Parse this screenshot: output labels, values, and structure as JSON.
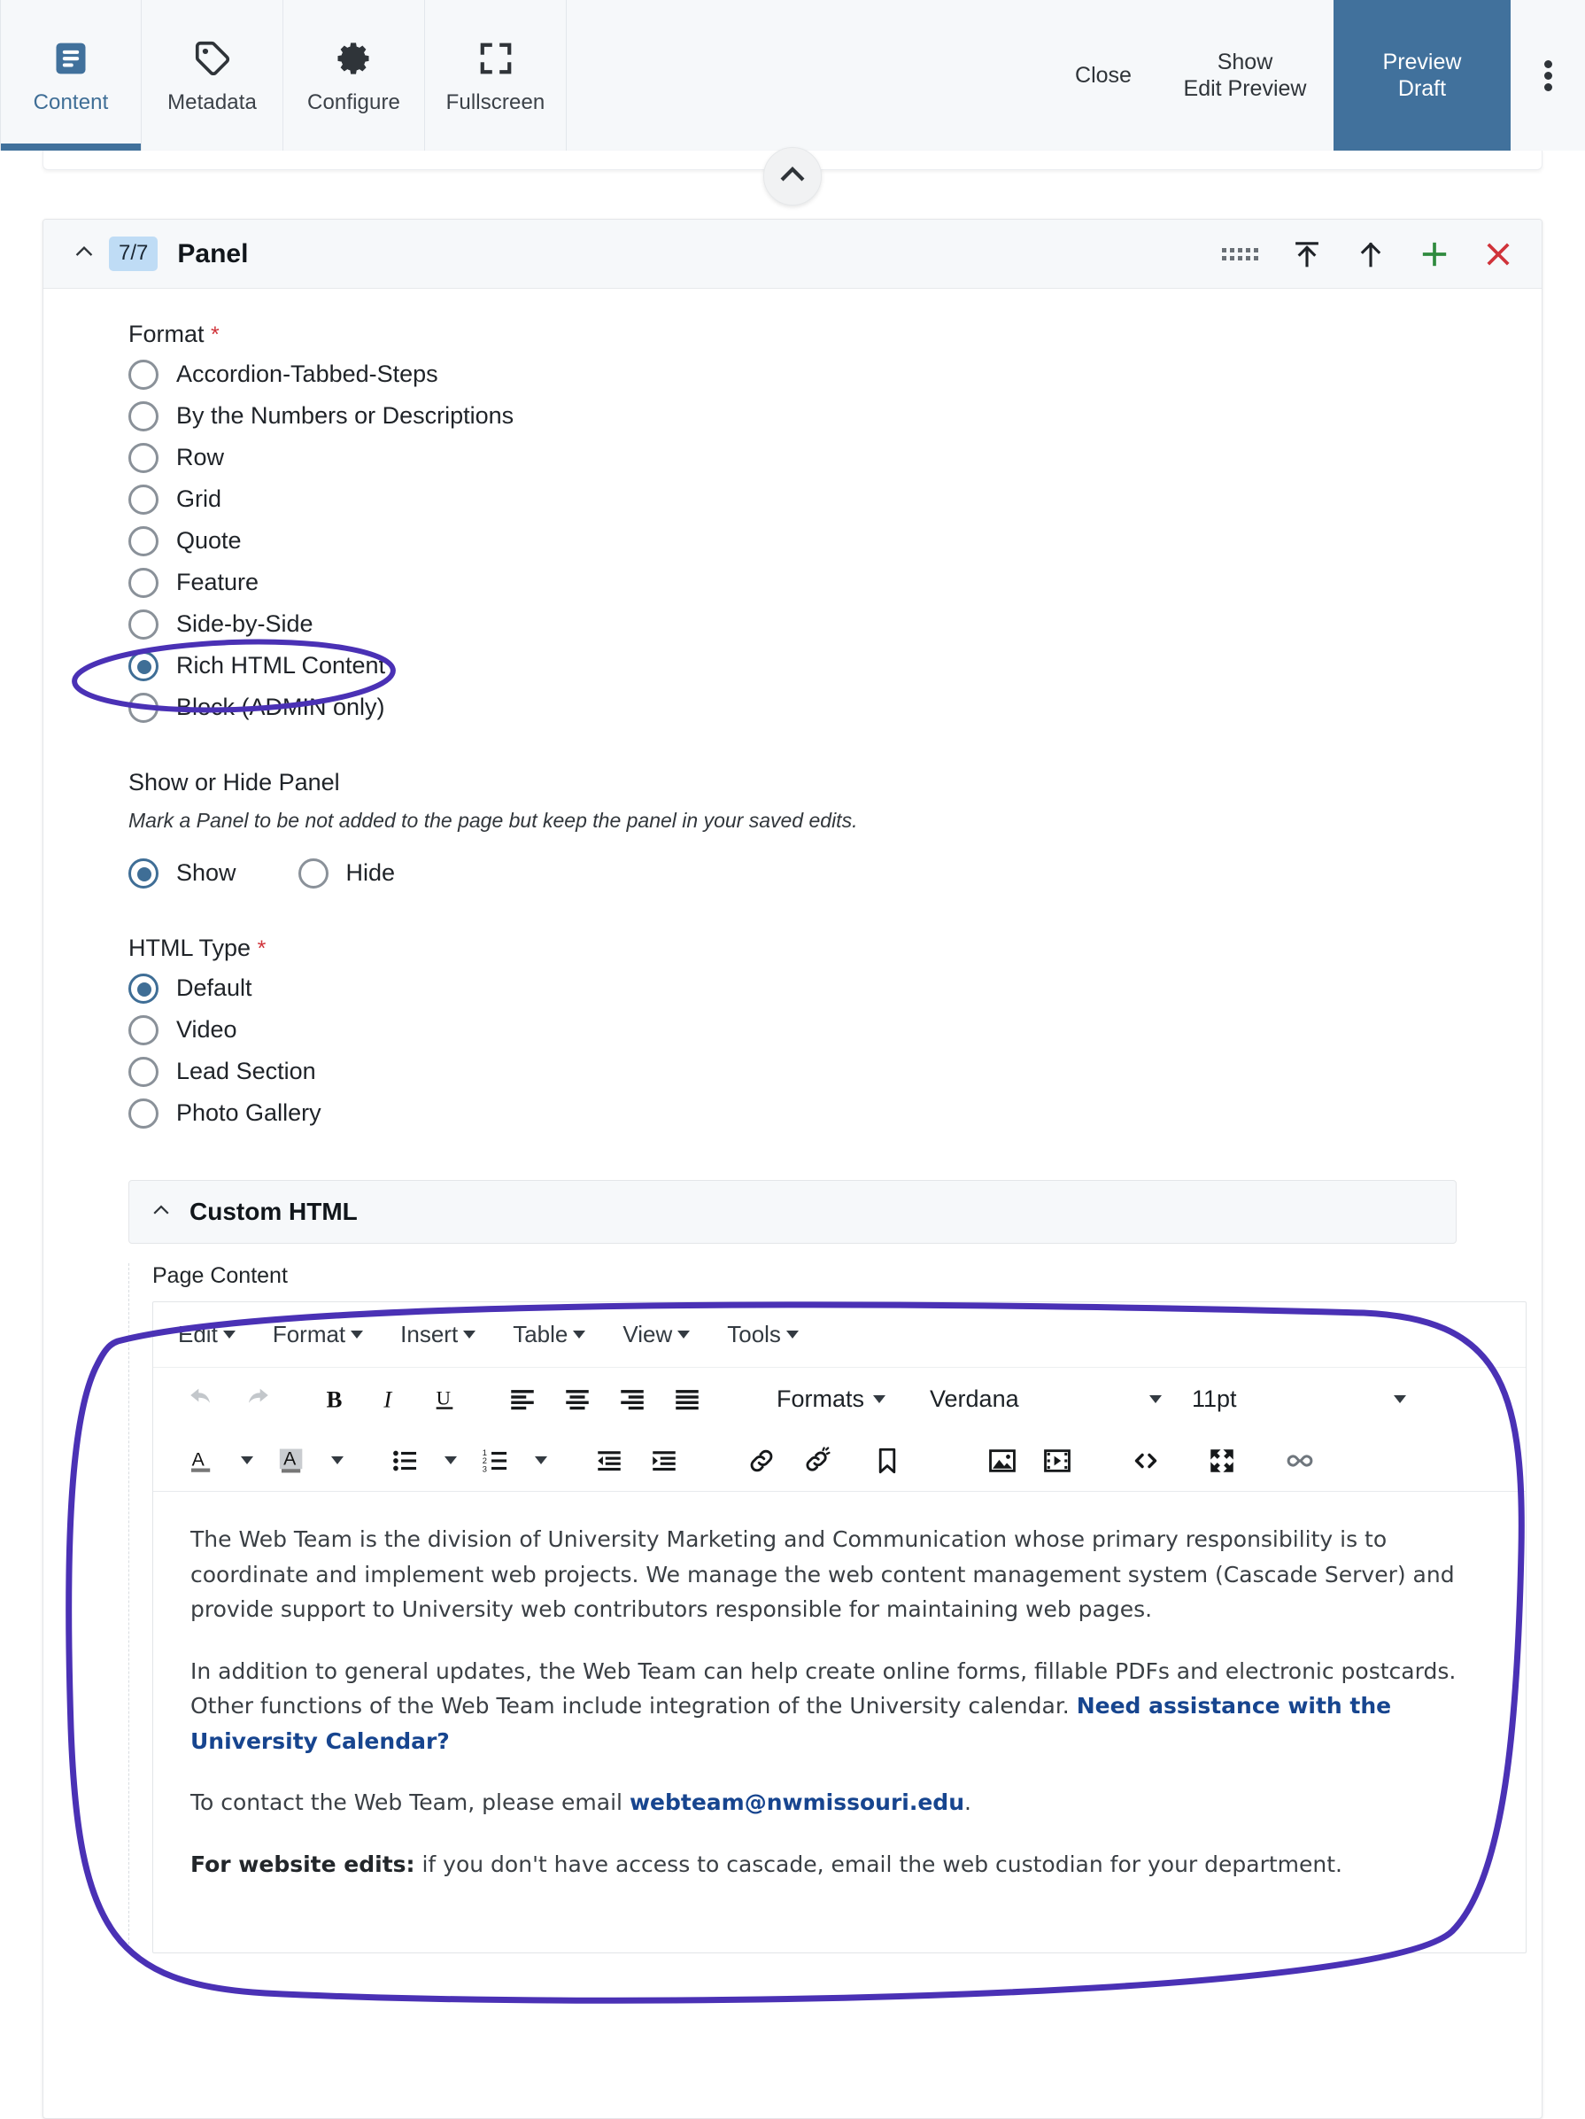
{
  "topbar": {
    "tabs": [
      {
        "label": "Content",
        "icon": "document-lines-icon",
        "active": true
      },
      {
        "label": "Metadata",
        "icon": "tag-icon",
        "active": false
      },
      {
        "label": "Configure",
        "icon": "gear-icon",
        "active": false
      },
      {
        "label": "Fullscreen",
        "icon": "expand-corners-icon",
        "active": false
      }
    ],
    "close_label": "Close",
    "show_edit_preview_label": "Show\nEdit Preview",
    "preview_draft_label": "Preview\nDraft",
    "more_icon": "kebab-menu-icon",
    "accent_color": "#41719c"
  },
  "collapse": {
    "icon": "chevron-up-icon"
  },
  "panel": {
    "caret_icon": "chevron-up-icon",
    "badge": "7/7",
    "title": "Panel",
    "head_icons": [
      {
        "name": "drag-handle-icon",
        "glyph": "dots"
      },
      {
        "name": "move-to-top-icon",
        "glyph": "arrow-to-top"
      },
      {
        "name": "move-up-icon",
        "glyph": "arrow-up"
      },
      {
        "name": "add-panel-icon",
        "glyph": "plus",
        "color": "#2f8a3e"
      },
      {
        "name": "remove-panel-icon",
        "glyph": "close",
        "color": "#d0333a"
      }
    ]
  },
  "format": {
    "label": "Format",
    "required_marker": "*",
    "options": [
      {
        "label": "Accordion-Tabbed-Steps",
        "selected": false
      },
      {
        "label": "By the Numbers or Descriptions",
        "selected": false
      },
      {
        "label": "Row",
        "selected": false
      },
      {
        "label": "Grid",
        "selected": false
      },
      {
        "label": "Quote",
        "selected": false
      },
      {
        "label": "Feature",
        "selected": false
      },
      {
        "label": "Side-by-Side",
        "selected": false
      },
      {
        "label": "Rich HTML Content",
        "selected": true
      },
      {
        "label": "Block (ADMIN only)",
        "selected": false
      }
    ]
  },
  "show_hide": {
    "label": "Show or Hide Panel",
    "hint": "Mark a Panel to be not added to the page but keep the panel in your saved edits.",
    "options": [
      {
        "label": "Show",
        "selected": true
      },
      {
        "label": "Hide",
        "selected": false
      }
    ]
  },
  "html_type": {
    "label": "HTML Type",
    "required_marker": "*",
    "options": [
      {
        "label": "Default",
        "selected": true
      },
      {
        "label": "Video",
        "selected": false
      },
      {
        "label": "Lead Section",
        "selected": false
      },
      {
        "label": "Photo Gallery",
        "selected": false
      }
    ]
  },
  "custom_html": {
    "caret_icon": "chevron-up-icon",
    "title": "Custom HTML",
    "field_label": "Page Content"
  },
  "editor": {
    "menus": [
      "Edit",
      "Format",
      "Insert",
      "Table",
      "View",
      "Tools"
    ],
    "toolbar_row1": [
      {
        "name": "undo-icon",
        "disabled": true
      },
      {
        "name": "redo-icon",
        "disabled": true
      },
      {
        "name": "bold-icon",
        "disabled": false
      },
      {
        "name": "italic-icon",
        "disabled": false
      },
      {
        "name": "underline-icon",
        "disabled": false
      },
      {
        "name": "align-left-icon",
        "disabled": false
      },
      {
        "name": "align-center-icon",
        "disabled": false
      },
      {
        "name": "align-right-icon",
        "disabled": false
      },
      {
        "name": "align-justify-icon",
        "disabled": false
      }
    ],
    "formats_label": "Formats",
    "font_family": "Verdana",
    "font_size": "11pt",
    "toolbar_row2": [
      {
        "name": "text-color-icon"
      },
      {
        "name": "background-color-icon"
      },
      {
        "name": "bullet-list-icon"
      },
      {
        "name": "numbered-list-icon"
      },
      {
        "name": "outdent-icon"
      },
      {
        "name": "indent-icon"
      },
      {
        "name": "insert-link-icon"
      },
      {
        "name": "remove-link-icon"
      },
      {
        "name": "anchor-icon"
      },
      {
        "name": "insert-image-icon"
      },
      {
        "name": "insert-media-icon"
      },
      {
        "name": "source-code-icon"
      },
      {
        "name": "fullscreen-icon"
      },
      {
        "name": "infinity-icon"
      }
    ],
    "content": {
      "p1": "The Web Team is the division of University Marketing and Communication whose primary responsibility is to coordinate and implement web projects. We manage the web content management system (Cascade Server) and provide support to University web contributors responsible for maintaining web pages.",
      "p2_text": "In addition to general updates, the Web Team can help create online forms, fillable PDFs and electronic postcards. Other functions of the Web Team include integration of the University calendar. ",
      "p2_link": "Need assistance with the University Calendar?",
      "p3_pre": "To contact the Web Team, please email ",
      "p3_link": "webteam@nwmissouri.edu",
      "p3_post": ".",
      "p4_bold": "For website edits:",
      "p4_text": " if you don't have access to cascade, email the web custodian for your department."
    }
  },
  "annotations": {
    "color": "#4a31b5",
    "shapes": [
      "ellipse-around-rich-html-content",
      "lasso-around-page-content-editor"
    ]
  }
}
